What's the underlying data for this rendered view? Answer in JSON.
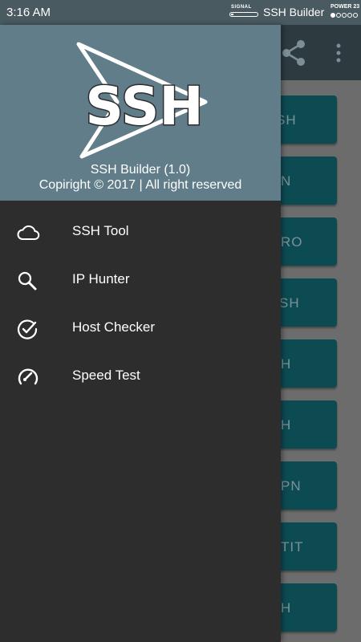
{
  "status_bar": {
    "time": "3:16 AM",
    "signal_label": "SIGNAL",
    "app_name": "SSH Builder",
    "power_label": "POWER 23"
  },
  "background": {
    "button_labels": [
      "SH",
      "N",
      "RO",
      "SH",
      "H",
      "H",
      "PN",
      "TIT",
      "H"
    ]
  },
  "drawer": {
    "logo_text": "SSH",
    "title": "SSH Builder (1.0)",
    "copyright": "Copiright © 2017 | All right reserved",
    "menu": [
      {
        "label": "SSH Tool",
        "icon": "cloud-icon"
      },
      {
        "label": "IP Hunter",
        "icon": "search-icon"
      },
      {
        "label": "Host Checker",
        "icon": "check-circle-icon"
      },
      {
        "label": "Speed Test",
        "icon": "speedometer-icon"
      }
    ]
  },
  "colors": {
    "status_bar": "#4a5a61",
    "drawer_header": "#617d8a",
    "drawer_body": "#2d2d2d",
    "button": "#0d4b53"
  }
}
